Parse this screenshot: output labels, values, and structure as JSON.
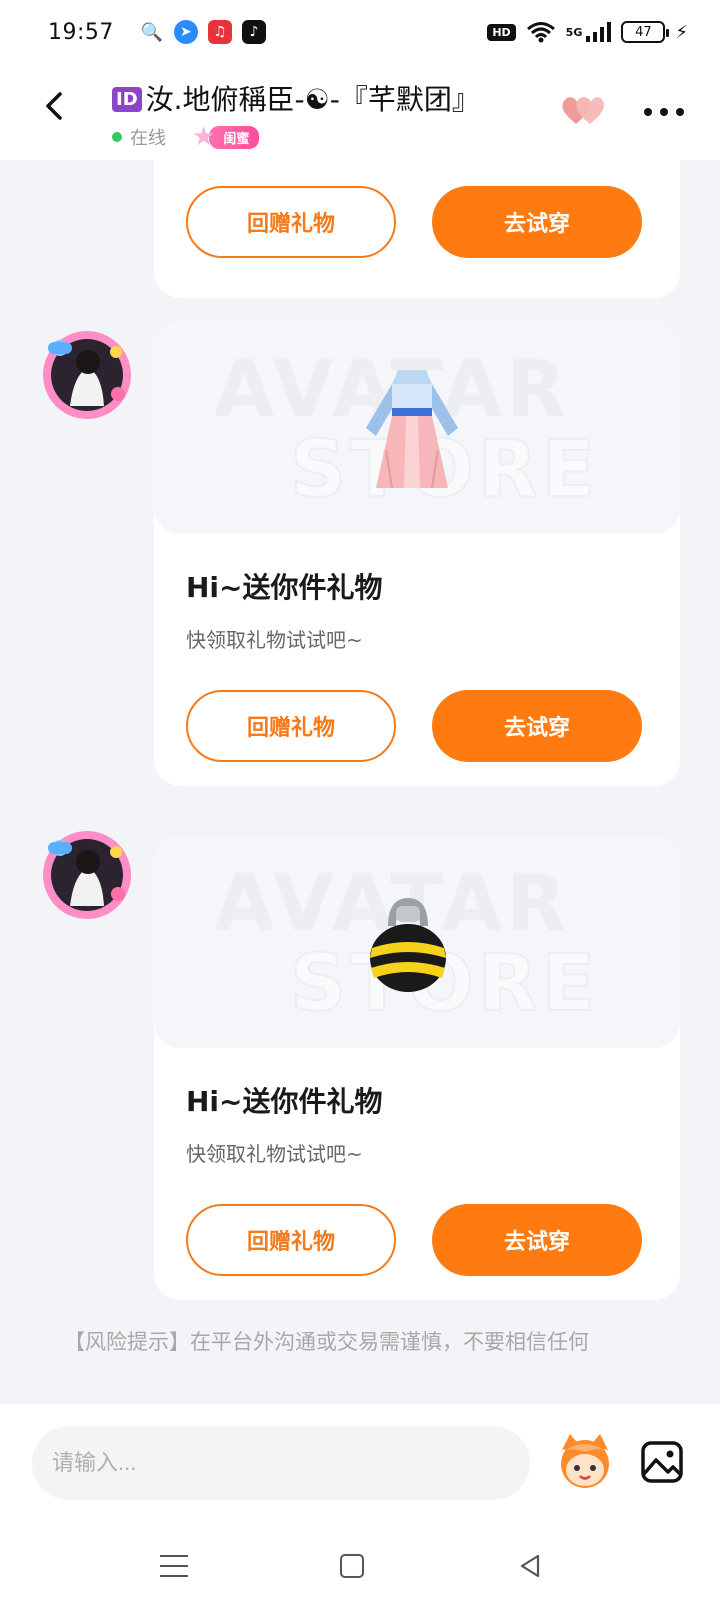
{
  "status_bar": {
    "time": "19:57",
    "hd": "HD",
    "network": "5G",
    "battery": "47"
  },
  "header": {
    "id_badge": "ID",
    "title": "汝.地俯稱臣-☯-『芊默团』",
    "online_status": "在线",
    "relation_badge": "闺蜜"
  },
  "messages": [
    {
      "return_gift_label": "回赠礼物",
      "try_on_label": "去试穿"
    },
    {
      "item": "hanfu-dress",
      "title": "Hi~送你件礼物",
      "subtitle": "快领取礼物试试吧~",
      "return_gift_label": "回赠礼物",
      "try_on_label": "去试穿"
    },
    {
      "item": "bee-bag",
      "title": "Hi~送你件礼物",
      "subtitle": "快领取礼物试试吧~",
      "return_gift_label": "回赠礼物",
      "try_on_label": "去试穿"
    }
  ],
  "watermark": {
    "line1": "AVATAR",
    "line2": "STORE"
  },
  "risk_tip": "【风险提示】在平台外沟通或交易需谨慎，不要相信任何",
  "input": {
    "placeholder": "请输入..."
  },
  "colors": {
    "accent_orange": "#ff7a10",
    "online_green": "#2ecc5f",
    "badge_pink": "#ff4d9a"
  }
}
